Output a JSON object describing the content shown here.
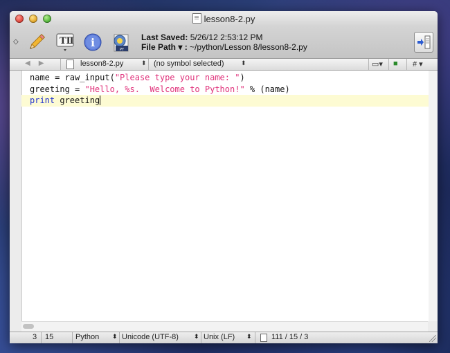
{
  "window": {
    "title": "lesson8-2.py"
  },
  "toolbar": {
    "last_saved_label": "Last Saved:",
    "last_saved_value": "5/26/12 2:53:12 PM",
    "file_path_label": "File Path ▾ :",
    "file_path_value": "~/python/Lesson 8/lesson8-2.py",
    "text_options_glyph": "TⅡ"
  },
  "navbar": {
    "file_name": "lesson8-2.py",
    "symbol": "(no symbol selected)",
    "markers_glyph": "#"
  },
  "editor": {
    "lines": [
      {
        "plain1": "name = raw_input(",
        "str": "\"Please type your name: \"",
        "plain2": ")"
      },
      {
        "plain1": "greeting = ",
        "str": "\"Hello, %s.  Welcome to Python!\"",
        "plain2": " % (name)"
      },
      {
        "kw": "print",
        "plain2": " greeting"
      }
    ]
  },
  "statusbar": {
    "line": "3",
    "column": "15",
    "language": "Python",
    "encoding": "Unicode (UTF-8)",
    "line_endings": "Unix (LF)",
    "counts": "111 / 15 / 3"
  },
  "colors": {
    "keyword": "#1d2fd0",
    "string": "#e0307a",
    "current_line": "#fdfbd3"
  }
}
